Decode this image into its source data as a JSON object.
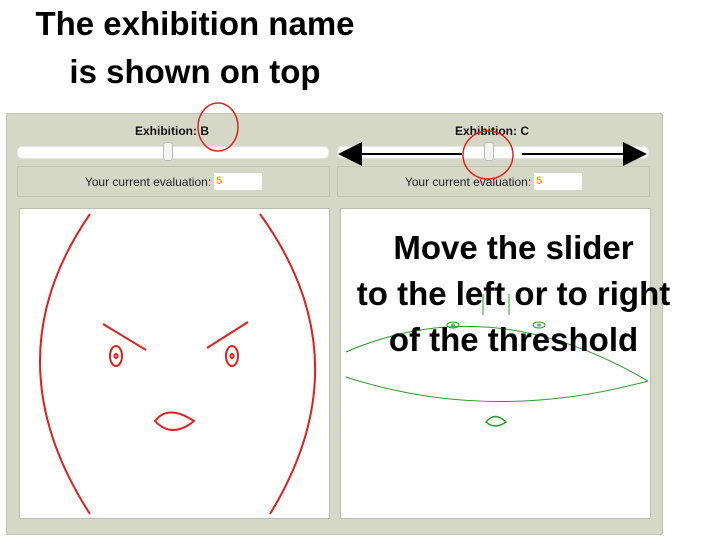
{
  "annotations": {
    "title_line1": "The exhibition name",
    "title_line2": "is shown on top",
    "move_line1": "Move the slider",
    "move_line2": "to the left or to right",
    "move_line3": "of the threshold"
  },
  "left": {
    "exhibition_label": "Exhibition:",
    "exhibition_name": "B",
    "slider_value": 0.49,
    "evaluation_label": "Your current evaluation:",
    "evaluation_value": "5",
    "face_color": "#e02020"
  },
  "right": {
    "exhibition_label": "Exhibition:",
    "exhibition_name": "C",
    "slider_value": 0.49,
    "evaluation_label": "Your current evaluation:",
    "evaluation_value": "5",
    "face_color": "#2a9a2a"
  },
  "colors": {
    "frame_bg": "#d6d8c7",
    "annotation_circle": "#d9261c",
    "evaluation_value": "#f0a31a"
  }
}
